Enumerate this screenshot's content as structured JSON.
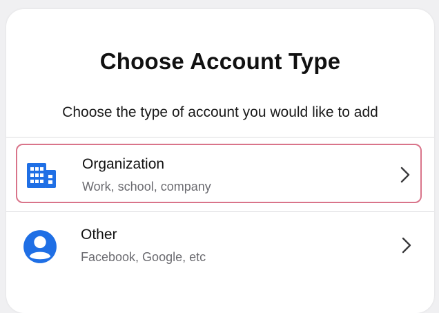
{
  "dialog": {
    "title": "Choose Account Type",
    "subtitle": "Choose the type of account you would like to add"
  },
  "options": [
    {
      "label": "Organization",
      "description": "Work, school, company",
      "icon": "building-icon",
      "selected": true
    },
    {
      "label": "Other",
      "description": "Facebook, Google, etc",
      "icon": "person-circle-icon",
      "selected": false
    }
  ],
  "colors": {
    "accent": "#1f6fe5",
    "selection_border": "#d9748a",
    "divider": "#dcdcdf"
  }
}
